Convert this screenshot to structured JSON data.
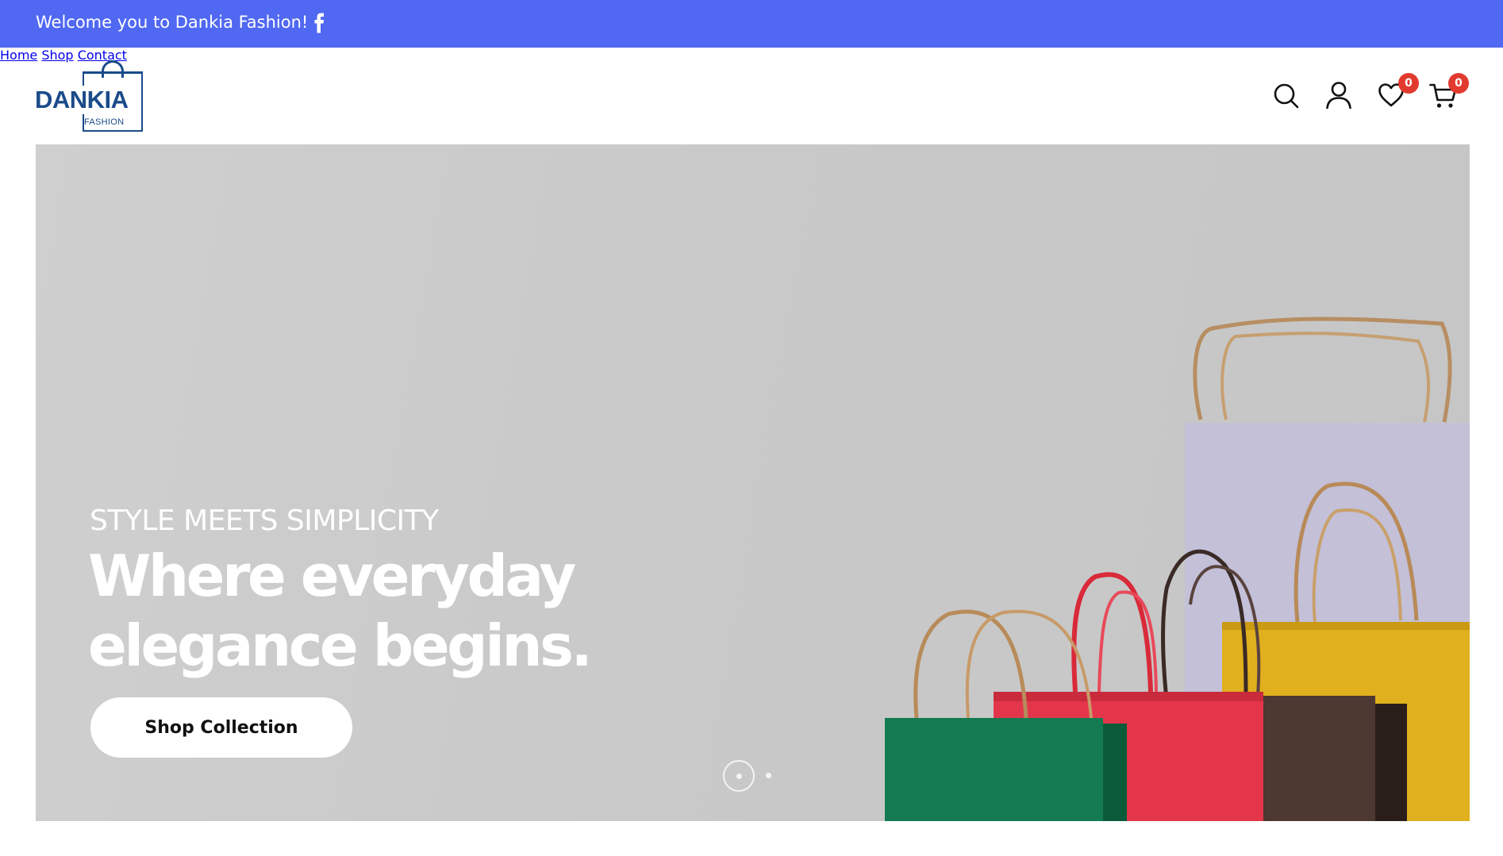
{
  "topbar": {
    "welcome": "Welcome you to Dankia Fashion!",
    "social_icon": "facebook-icon"
  },
  "logo": {
    "word": "DANKIA",
    "sub": "FASHION"
  },
  "nav": {
    "items": [
      {
        "label": "Home"
      },
      {
        "label": "Shop"
      },
      {
        "label": "Contact"
      }
    ]
  },
  "header_icons": {
    "search": "search-icon",
    "account": "user-icon",
    "wishlist": "heart-icon",
    "wishlist_count": "0",
    "cart": "cart-icon",
    "cart_count": "0"
  },
  "hero": {
    "eyebrow": "STYLE MEETS SIMPLICITY",
    "headline_line1": "Where everyday",
    "headline_line2": "elegance begins.",
    "cta_label": "Shop Collection",
    "slides_total": 2,
    "slide_active": 1
  },
  "colors": {
    "topbar": "#5068f2",
    "badge": "#e23a2e",
    "logo": "#1b4b8a"
  }
}
